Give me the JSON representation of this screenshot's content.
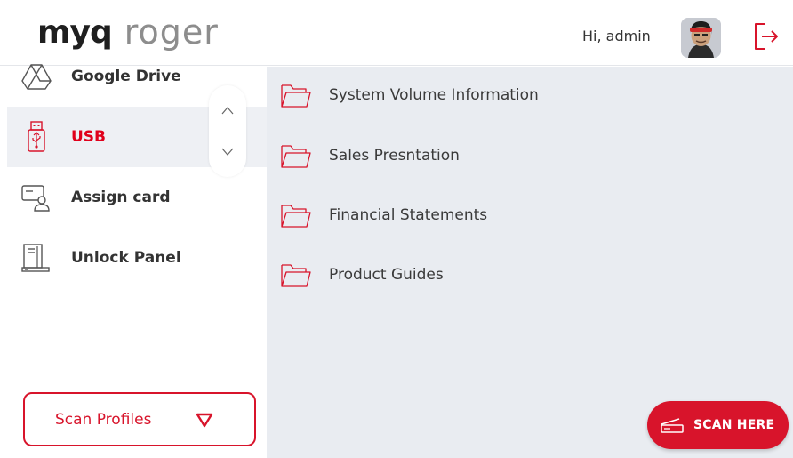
{
  "header": {
    "logo_primary": "myq",
    "logo_secondary": "roger",
    "greeting": "Hi, admin",
    "avatar_icon": "user-avatar",
    "logout_icon": "logout-icon"
  },
  "sidebar": {
    "items": [
      {
        "label": "Google Drive",
        "icon": "google-drive-icon",
        "active": false
      },
      {
        "label": "USB",
        "icon": "usb-icon",
        "active": true
      },
      {
        "label": "Assign card",
        "icon": "assign-card-icon",
        "active": false
      },
      {
        "label": "Unlock Panel",
        "icon": "unlock-panel-icon",
        "active": false
      }
    ],
    "scroll_up_icon": "chevron-up-icon",
    "scroll_down_icon": "chevron-down-icon",
    "scan_profiles_label": "Scan Profiles"
  },
  "main": {
    "folders": [
      {
        "label": "System Volume Information"
      },
      {
        "label": "Sales Presntation"
      },
      {
        "label": "Financial Statements"
      },
      {
        "label": "Product Guides"
      }
    ],
    "scan_button_label": "SCAN HERE"
  },
  "colors": {
    "accent": "#d8142b",
    "active_text": "#e0001b",
    "panel_bg": "#e9ecf1",
    "active_item_bg": "#eef0f4"
  }
}
